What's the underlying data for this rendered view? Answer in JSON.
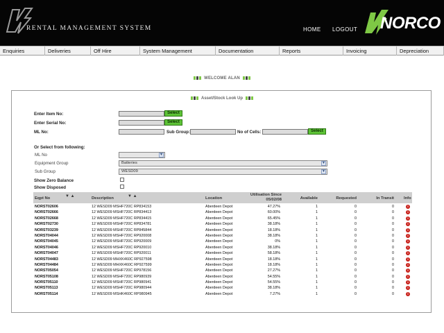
{
  "header": {
    "app_title": "RENTAL MANAGEMENT SYSTEM",
    "home": "HOME",
    "logout": "LOGOUT",
    "brand": "NORCO",
    "brand_color": "#7ec845"
  },
  "menu": [
    "Enquiries",
    "Deliveries",
    "Off Hire",
    "System Management",
    "Documentation",
    "Reports",
    "Invoicing",
    "Depreciation"
  ],
  "welcome": "WELCOME ALAN",
  "panel_title": "Asset/Stock Look Up",
  "form": {
    "item_no_label": "Enter Item No:",
    "serial_no_label": "Enter Serial No:",
    "ml_no_label": "ML No:",
    "sub_group_label": "Sub Group:",
    "no_cells_label": "No of Cells:",
    "select_label": "Select",
    "or_select": "Or Select from following:",
    "ml_no_small": "ML No",
    "equipment_group_label": "Equipment Group",
    "equipment_group_value": "Batteries",
    "sub_group_small": "Sub Group",
    "sub_group_value": "WESD09",
    "show_zero_balance": "Show Zero Balance",
    "show_disposed": "Show Disposed"
  },
  "table": {
    "headers": {
      "id": "Eqpt No",
      "desc": "Description",
      "loc": "Location",
      "util_1": "Utilisation Since",
      "util_2": "05/02/08",
      "avail": "Available",
      "req": "Requested",
      "tran": "In Transit",
      "info": "Info"
    },
    "sort_icons": "▼ ▲",
    "rows": [
      {
        "id": "NORST02606",
        "desc": "12 WESD09 MSHF720C RP834153",
        "loc": "Aberdeen Depot",
        "util": "47.27%",
        "avail": "1",
        "req": "0",
        "tran": "0"
      },
      {
        "id": "NORST02666",
        "desc": "12 WESD09 MSHF720C RP834413",
        "loc": "Aberdeen Depot",
        "util": "60.00%",
        "avail": "1",
        "req": "0",
        "tran": "0"
      },
      {
        "id": "NORST02668",
        "desc": "12 WESD09 MSHF720C RP834415",
        "loc": "Aberdeen Depot",
        "util": "65.45%",
        "avail": "1",
        "req": "0",
        "tran": "0"
      },
      {
        "id": "NORST02730",
        "desc": "12 WESD09 MSHF720C RP834781",
        "loc": "Aberdeen Depot",
        "util": "38.18%",
        "avail": "1",
        "req": "0",
        "tran": "0"
      },
      {
        "id": "NORST03239",
        "desc": "12 WESD09 MSHF720C RP845844",
        "loc": "Aberdeen Depot",
        "util": "18.18%",
        "avail": "1",
        "req": "0",
        "tran": "0"
      },
      {
        "id": "NORST04044",
        "desc": "12 WESD09 MSHF720C RP920008",
        "loc": "Aberdeen Depot",
        "util": "38.18%",
        "avail": "1",
        "req": "0",
        "tran": "0"
      },
      {
        "id": "NORST04045",
        "desc": "12 WESD09 MSHF720C RP920009",
        "loc": "Aberdeen Depot",
        "util": "0%",
        "avail": "1",
        "req": "0",
        "tran": "0"
      },
      {
        "id": "NORST04046",
        "desc": "12 WESD09 MSHF720C RP920010",
        "loc": "Aberdeen Depot",
        "util": "38.18%",
        "avail": "1",
        "req": "0",
        "tran": "0"
      },
      {
        "id": "NORST04047",
        "desc": "12 WESD09 MSHF720C RP920011",
        "loc": "Aberdeen Depot",
        "util": "58.18%",
        "avail": "1",
        "req": "0",
        "tran": "0"
      },
      {
        "id": "NORST04483",
        "desc": "12 WESD09 MHXK460C RP927598",
        "loc": "Aberdeen Depot",
        "util": "18.18%",
        "avail": "1",
        "req": "0",
        "tran": "0"
      },
      {
        "id": "NORST04484",
        "desc": "12 WESD09 MHXK460C RP927599",
        "loc": "Aberdeen Depot",
        "util": "18.18%",
        "avail": "1",
        "req": "0",
        "tran": "0"
      },
      {
        "id": "NORST05054",
        "desc": "12 WESD09 MSHF720C RP978156",
        "loc": "Aberdeen Depot",
        "util": "27.27%",
        "avail": "1",
        "req": "0",
        "tran": "0"
      },
      {
        "id": "NORST05108",
        "desc": "12 WESD09 MSHF720C RP980939",
        "loc": "Aberdeen Depot",
        "util": "54.55%",
        "avail": "1",
        "req": "0",
        "tran": "0"
      },
      {
        "id": "NORST05110",
        "desc": "12 WESD09 MSHF720C RP980941",
        "loc": "Aberdeen Depot",
        "util": "54.55%",
        "avail": "1",
        "req": "0",
        "tran": "0"
      },
      {
        "id": "NORST05113",
        "desc": "12 WESD09 MSHF720C RP980944",
        "loc": "Aberdeen Depot",
        "util": "38.18%",
        "avail": "1",
        "req": "0",
        "tran": "0"
      },
      {
        "id": "NORST05114",
        "desc": "12 WESD09 MSHK460C RP980945",
        "loc": "Aberdeen Depot",
        "util": "7.27%",
        "avail": "1",
        "req": "0",
        "tran": "0"
      }
    ]
  }
}
